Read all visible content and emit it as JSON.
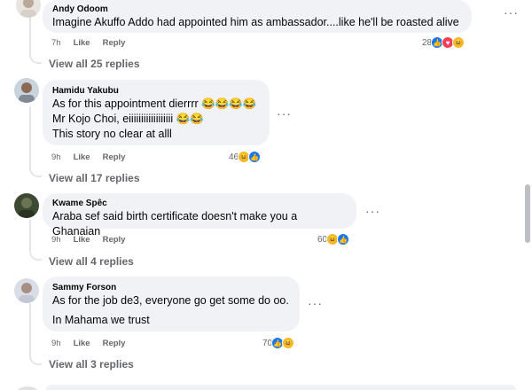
{
  "comments": [
    {
      "author": "Andy Odoom",
      "lines": [
        "Imagine Akuffo Addo had appointed him as ambassador....like he'll be roasted alive"
      ],
      "time": "7h",
      "like_label": "Like",
      "reply_label": "Reply",
      "reaction_count": "28",
      "reactions": [
        "like-icon",
        "love-icon",
        "haha-icon"
      ],
      "view_replies": "View all 25 replies"
    },
    {
      "author": "Hamidu Yakubu",
      "lines": [
        "As for this appointment dierrrr 😂😂😂😂",
        "Mr Kojo Choi, eiiiiiiiiiiiiiiiiii 😂😂",
        "This story no clear at alll"
      ],
      "time": "9h",
      "like_label": "Like",
      "reply_label": "Reply",
      "reaction_count": "46",
      "reactions": [
        "haha-icon",
        "like-icon"
      ],
      "view_replies": "View all 17 replies"
    },
    {
      "author": "Kwame Spêc",
      "lines": [
        "Araba sef said birth certificate doesn't make you a Ghanaian"
      ],
      "time": "9h",
      "like_label": "Like",
      "reply_label": "Reply",
      "reaction_count": "60",
      "reactions": [
        "haha-icon",
        "like-icon"
      ],
      "view_replies": "View all 4 replies"
    },
    {
      "author": "Sammy Forson",
      "lines": [
        "As for the job de3, everyone go get some do oo.",
        "In Mahama we trust"
      ],
      "time": "9h",
      "like_label": "Like",
      "reply_label": "Reply",
      "reaction_count": "70",
      "reactions": [
        "like-icon",
        "haha-icon"
      ],
      "view_replies": "View all 3 replies"
    }
  ],
  "more_icon": "more-options-icon",
  "colors": {
    "bubble": "#f0f2f5",
    "secondary_text": "#65676b",
    "like_blue": "#1877f2",
    "love_red": "#f33e58",
    "haha_yellow": "#f7b928"
  }
}
